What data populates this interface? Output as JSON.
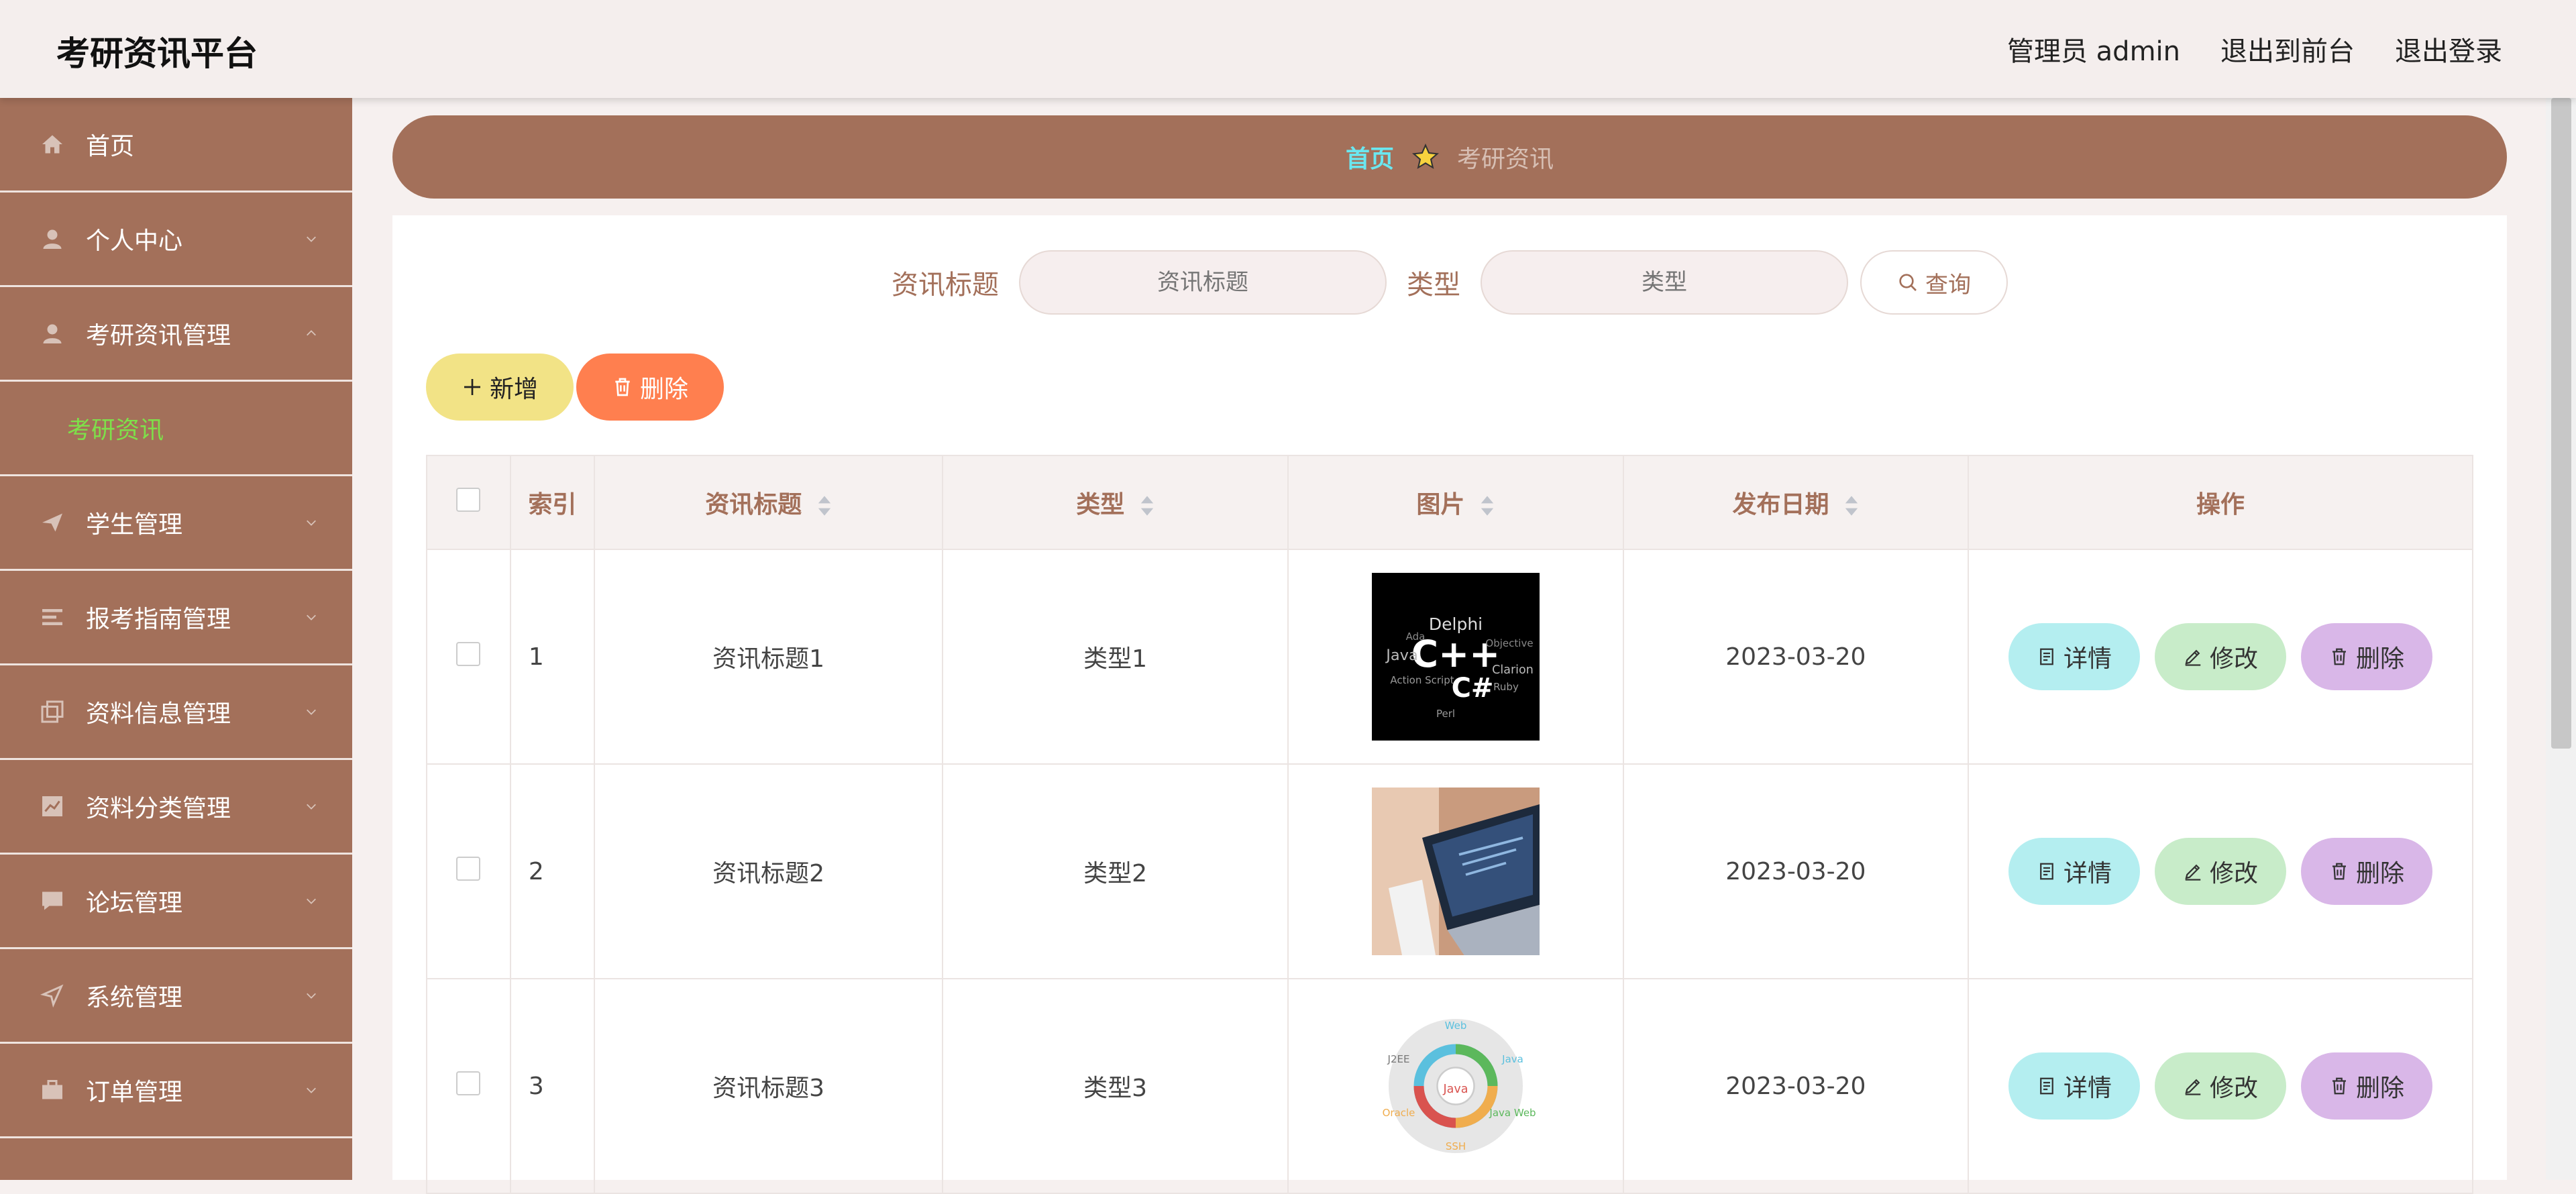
{
  "header": {
    "app_title": "考研资讯平台",
    "admin_label": "管理员 admin",
    "to_front_label": "退出到前台",
    "logout_label": "退出登录"
  },
  "sidebar": {
    "items": [
      {
        "label": "首页",
        "icon": "home-icon"
      },
      {
        "label": "个人中心",
        "icon": "user-icon"
      },
      {
        "label": "考研资讯管理",
        "icon": "user-icon"
      },
      {
        "label": "学生管理",
        "icon": "send-icon"
      },
      {
        "label": "报考指南管理",
        "icon": "list-icon"
      },
      {
        "label": "资料信息管理",
        "icon": "copy-icon"
      },
      {
        "label": "资料分类管理",
        "icon": "chart-icon"
      },
      {
        "label": "论坛管理",
        "icon": "message-icon"
      },
      {
        "label": "系统管理",
        "icon": "navigation-icon"
      },
      {
        "label": "订单管理",
        "icon": "briefcase-icon"
      }
    ],
    "active_sub": "考研资讯"
  },
  "breadcrumb": {
    "home": "首页",
    "current": "考研资讯"
  },
  "search": {
    "title_label": "资讯标题",
    "title_placeholder": "资讯标题",
    "type_label": "类型",
    "type_placeholder": "类型",
    "query_label": "查询"
  },
  "actions": {
    "add_label": "新增",
    "delete_label": "删除"
  },
  "table": {
    "headers": {
      "index": "索引",
      "title": "资讯标题",
      "type": "类型",
      "image": "图片",
      "date": "发布日期",
      "ops": "操作"
    },
    "rows": [
      {
        "index": "1",
        "title": "资讯标题1",
        "type": "类型1",
        "date": "2023-03-20"
      },
      {
        "index": "2",
        "title": "资讯标题2",
        "type": "类型2",
        "date": "2023-03-20"
      },
      {
        "index": "3",
        "title": "资讯标题3",
        "type": "类型3",
        "date": "2023-03-20"
      }
    ],
    "op_labels": {
      "detail": "详情",
      "edit": "修改",
      "delete": "删除"
    },
    "image_texts": {
      "row1": [
        "Delphi",
        "C++",
        "C#",
        "Java",
        "Clarion",
        "Ruby",
        "Perl",
        "Action Script",
        "Ada",
        "Objective"
      ],
      "row3": [
        "Web",
        "Java",
        "J2EE",
        "Java Web",
        "Oracle",
        "SSH",
        "Java"
      ]
    }
  },
  "colors": {
    "primary": "#a3705a",
    "breadcrumb_home": "#6ae7f0",
    "active_sub": "#7ee04a",
    "add_button": "#f2e386",
    "delete_button": "#ff7f4f",
    "detail_button": "#b4eef0",
    "edit_button": "#c8ecc9",
    "op_delete_button": "#d9b7e8"
  }
}
